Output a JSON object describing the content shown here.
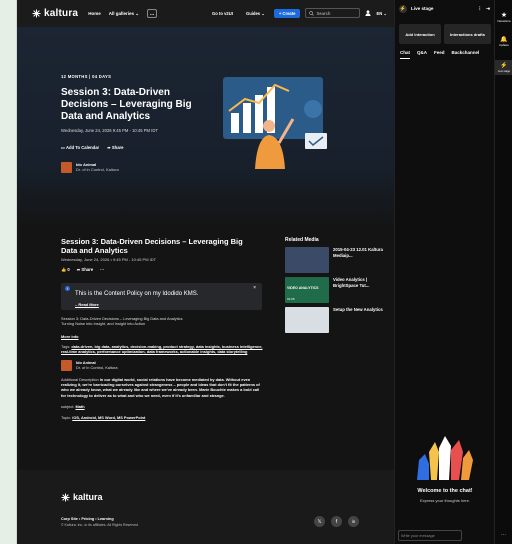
{
  "topbar": {
    "brand": "kaltura",
    "nav": [
      "Home",
      "All galleries"
    ],
    "more": "...",
    "go_v2ui": "Go to v2UI",
    "guides": "Guides",
    "create": "+ Create",
    "search_placeholder": "Search",
    "lang": "EN"
  },
  "hero": {
    "meta": "12 MONTHS | 04 DAYS",
    "title": "Session 3: Data-Driven Decisions – Leveraging Big Data and Analytics",
    "date": "Wednesday, June 24, 2026 9:45 PM - 10:45 PM IDT",
    "add_calendar": "Add To Calendar",
    "share": "Share",
    "presenter_name": "Ido Animal",
    "presenter_role": "Dr. of in Control, Kaltura"
  },
  "article": {
    "title": "Session 3: Data-Driven Decisions – Leveraging Big Data and Analytics",
    "date": "Wednesday, June 24, 2026 • 9:45 PM - 10:45 PM IDT",
    "likes": "0",
    "share": "Share",
    "more": "···",
    "policy_text": "This is the Content Policy on my Idodido KMS.",
    "policy_link": "– Read More",
    "desc1": "Session 3: Data-Driven Decisions – Leveraging Big Data and Analytics",
    "desc2": "Turning Noise into Insight, and Insight into Action",
    "more_info": "More info",
    "tags_label": "Tags",
    "tags": "data-driven, big data, analytics, decision-making, product strategy, data insights, business intelligence, real-time analytics, performance optimization, data frameworks, actionable insights, data storytelling",
    "presenter_name": "Ido Animal",
    "presenter_role": "Dr. of in Control, Kaltura",
    "add_desc_label": "Additional Description",
    "add_desc": "In our digital world, social relations have become mediated by data. Without even realizing it, we're barricading ourselves against strangeness – people and ideas that don't fit the patterns of who we already know, what we already like and where we've already been. Marie Bouchte makes a bold call for technology to deliver as to what and who we need, even if it's unfamiliar and strange.",
    "subject_label": "subject",
    "subject": "Math",
    "topic_label": "Topic",
    "topic": "iOS, Android, MS Word, MS PowerPoint"
  },
  "related": {
    "heading": "Related Media",
    "items": [
      {
        "title": "2015-04-23 12.01 Kaltura Mediaip...",
        "thumb": "#3b4a66"
      },
      {
        "title": "Video Analytics | BrightSpace Tut...",
        "thumb": "#1f6b4a",
        "badge": "VIDEO ANALYTICS",
        "dur": "01:05"
      },
      {
        "title": "Setup the New Analytics",
        "thumb": "#d9dde4"
      }
    ]
  },
  "footer": {
    "brand": "kaltura",
    "links": "Corp Site  •  Pricing  •  Learning",
    "copyright": "© Kaltura, Inc. or its affiliates. All Rights Reserved"
  },
  "panel": {
    "title": "Live stage",
    "add_interaction": "Add interaction",
    "drafts": "Interactions drafts",
    "tabs": [
      "Chat",
      "Q&A",
      "Feed",
      "Backchannel"
    ],
    "welcome": "Welcome to the chat!",
    "welcome_sub": "Express your thoughts here.",
    "input_placeholder": "Write your message"
  },
  "farbar": {
    "items": [
      "Interactions",
      "Updates",
      "Live stage"
    ]
  },
  "colors": {
    "accent": "#1c6bde",
    "orange": "#c45a2a"
  }
}
